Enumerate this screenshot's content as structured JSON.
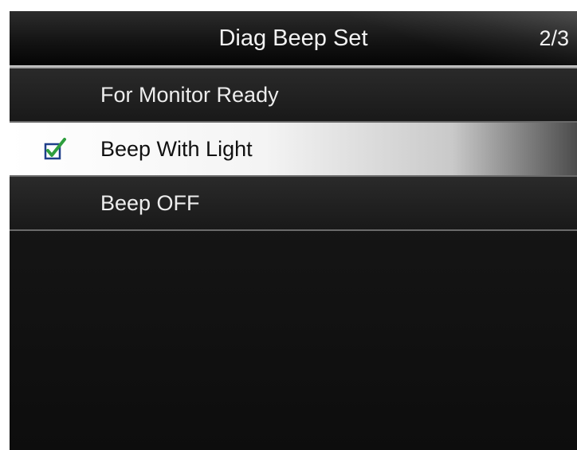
{
  "header": {
    "title": "Diag Beep Set",
    "page_counter": "2/3"
  },
  "menu": {
    "items": [
      {
        "label": "For Monitor Ready",
        "selected": false,
        "checked": false
      },
      {
        "label": "Beep With Light",
        "selected": true,
        "checked": true
      },
      {
        "label": "Beep OFF",
        "selected": false,
        "checked": false
      }
    ]
  },
  "icons": {
    "check": "checkbox-checked-icon"
  },
  "colors": {
    "checkmark": "#2e9e3e",
    "checkbox_border": "#1f3f8a",
    "highlight": "#ffffff"
  }
}
